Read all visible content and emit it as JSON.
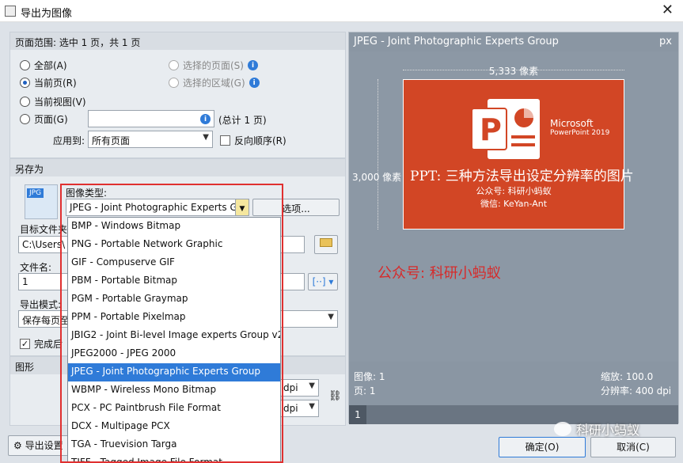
{
  "window": {
    "title": "导出为图像",
    "close_label": "✕"
  },
  "page_range": {
    "header": "页面范围: 选中 1 页，共 1 页",
    "all_label": "全部(A)",
    "current_label": "当前页(R)",
    "current_view_label": "当前视图(V)",
    "pages_label": "页面(G)",
    "pages_total": "(总计 1 页)",
    "selected_pages_label": "选择的页面(S)",
    "selected_area_label": "选择的区域(G)",
    "apply_to_label": "应用到:",
    "apply_to_value": "所有页面",
    "reverse_order_label": "反向顺序(R)"
  },
  "save_as": {
    "header": "另存为",
    "image_type_label": "图像类型:",
    "image_type_value": "JPEG - Joint Photographic Experts G",
    "options_button": "选项...",
    "target_file_label": "目标文件夹",
    "target_file_value": "C:\\Users\\",
    "filename_label": "文件名:",
    "filename_value": "1",
    "export_mode_label": "导出模式:",
    "export_mode_value": "保存每页至",
    "complete_label": "完成后",
    "file_icon_label": "JPG"
  },
  "graphics": {
    "header": "图形",
    "dpi1": "dpi",
    "dpi2": "dpi"
  },
  "dropdown": {
    "items": [
      "BMP - Windows Bitmap",
      "PNG - Portable Network Graphic",
      "GIF - Compuserve GIF",
      "PBM - Portable Bitmap",
      "PGM - Portable Graymap",
      "PPM - Portable Pixelmap",
      "JBIG2 - Joint Bi-level Image experts Group v2",
      "JPEG2000 - JPEG 2000",
      "JPEG - Joint Photographic Experts Group",
      "WBMP - Wireless Mono Bitmap",
      "PCX - PC Paintbrush File Format",
      "DCX - Multipage PCX",
      "TGA - Truevision Targa",
      "TIFF - Tagged Image File Format"
    ],
    "selected_index": 8
  },
  "preview": {
    "header": "JPEG - Joint Photographic Experts Group",
    "unit": "px",
    "width_label": "5,333 像素",
    "height_label": "3,000 像素",
    "slide_title": "PPT: 三种方法导出设定分辨率的图片",
    "slide_line2": "公众号: 科研小蚂蚁",
    "slide_line3": "微信: KeYan-Ant",
    "ms_label": "Microsoft",
    "pp_label": "PowerPoint 2019",
    "overlay_text": "公众号: 科研小蚂蚁",
    "image_label": "图像: 1",
    "page_label": "页: 1",
    "zoom_label": "缩放: 100.0",
    "resolution_label": "分辨率: 400 dpi",
    "page_number": "1"
  },
  "footer": {
    "settings_button": "导出设置",
    "ok_button": "确定(O)",
    "cancel_button": "取消(C)",
    "watermark": "科研小蚂蚁"
  },
  "colors": {
    "accent": "#2f7bd8",
    "slide_bg": "#d24625",
    "highlight_red": "#e03030"
  }
}
